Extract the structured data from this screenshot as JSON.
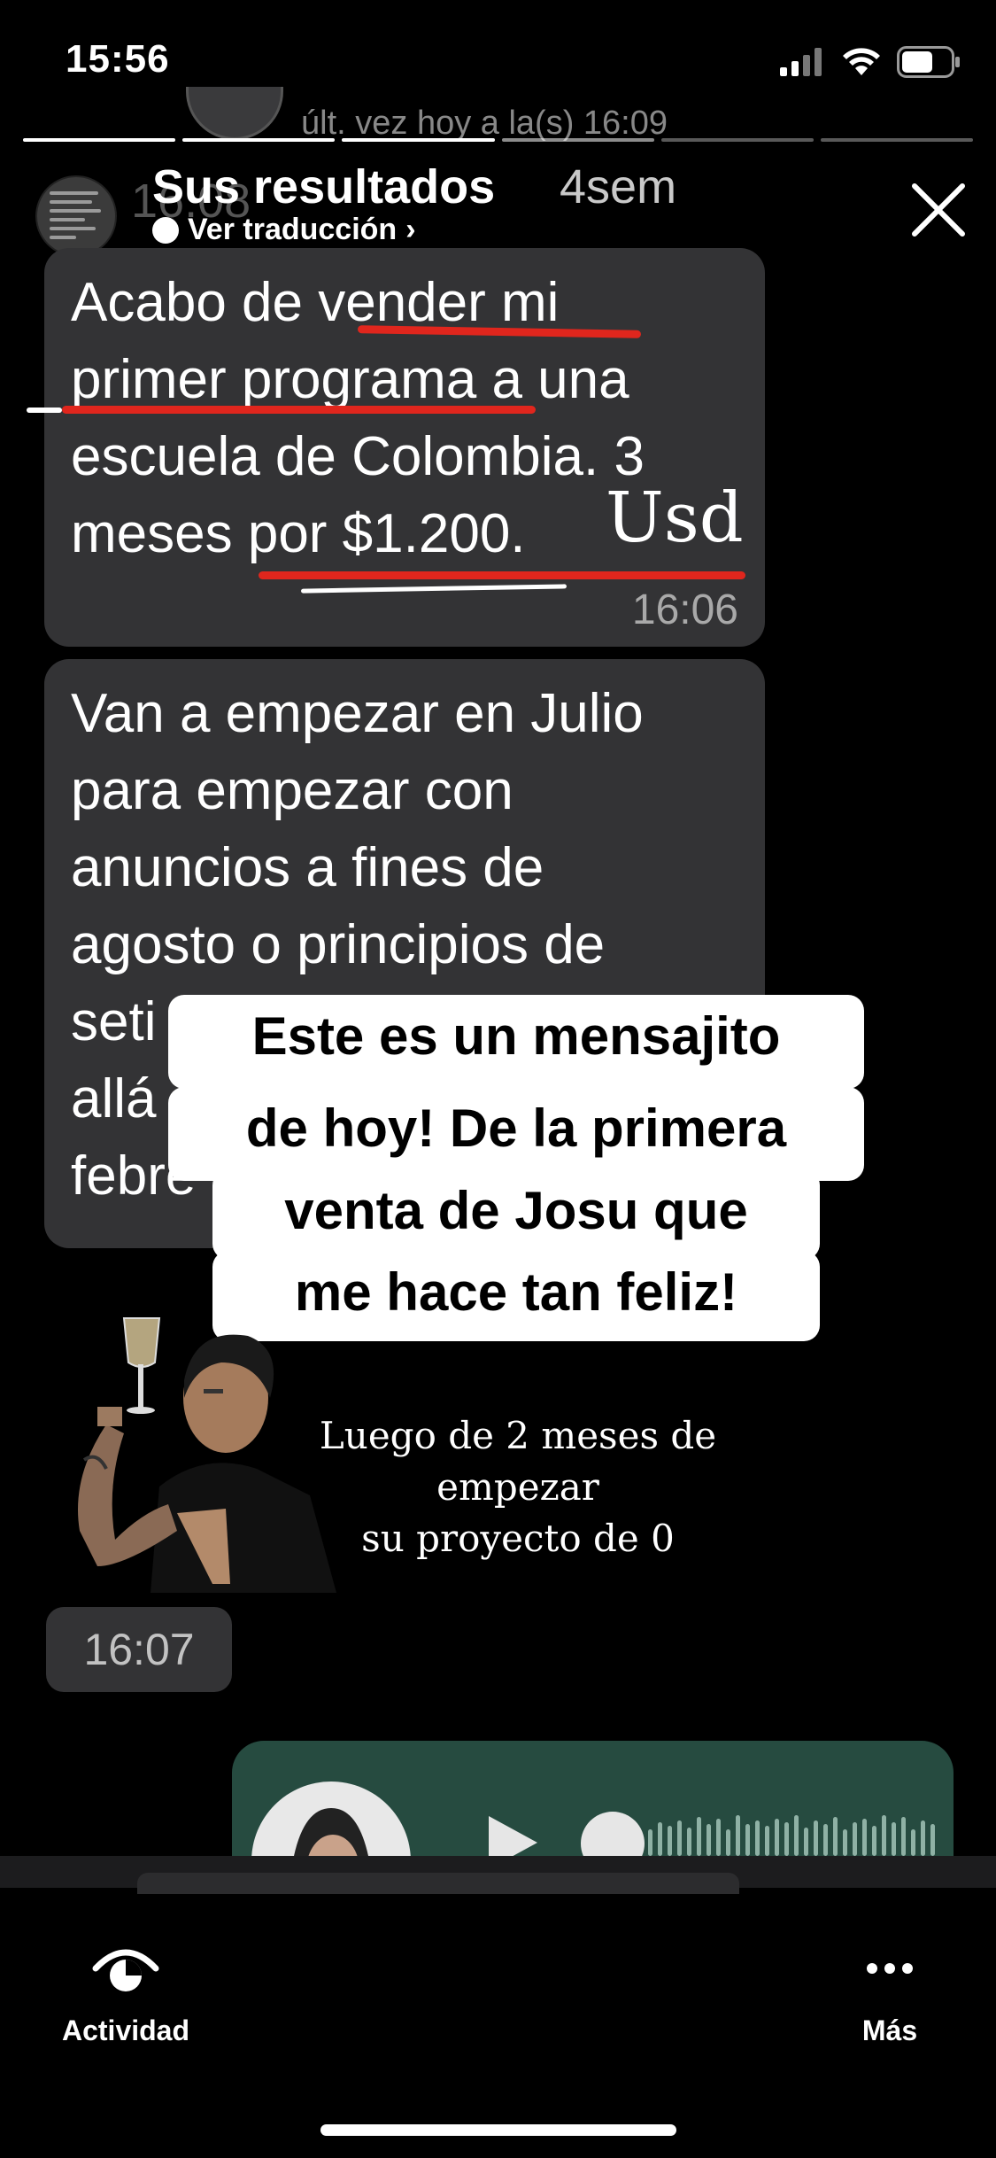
{
  "status_bar": {
    "time": "15:56"
  },
  "chat_behind": {
    "header_text": "últ. vez hoy a la(s) 16:09"
  },
  "story": {
    "username": "Sus resultados",
    "age": "4sem",
    "translate_label": "Ver traducción",
    "translate_chevron": "›",
    "background_time_ghost": "16:08"
  },
  "messages": [
    {
      "lines": [
        "Acabo de vender mi",
        "primer programa a una",
        "escuela de Colombia. 3",
        "meses por $1.200."
      ],
      "handwritten_suffix": "Usd",
      "time": "16:06"
    },
    {
      "lines": [
        "Van a empezar en Julio",
        "para empezar con",
        "anuncios a fines de",
        "agosto o principios de",
        "seti",
        "allá",
        "febre"
      ]
    }
  ],
  "sticker_text": [
    "Este es un mensajito",
    "de hoy! De la primera",
    "venta de Josu que",
    "me hace tan feliz!"
  ],
  "caption": [
    "Luego de 2 meses de empezar",
    "su proyecto de 0"
  ],
  "time_chip": "16:07",
  "toolbar": {
    "activity_label": "Actividad",
    "more_label": "Más"
  },
  "icons": {
    "close": "close-icon",
    "activity": "activity-eye-icon",
    "more": "more-dots-icon",
    "signal": "signal-icon",
    "wifi": "wifi-icon",
    "battery": "battery-icon",
    "globe": "globe-icon",
    "play": "play-icon"
  },
  "colors": {
    "background": "#000000",
    "bubble": "#333335",
    "underline": "#e0261d",
    "audio_bubble": "#264b40"
  }
}
